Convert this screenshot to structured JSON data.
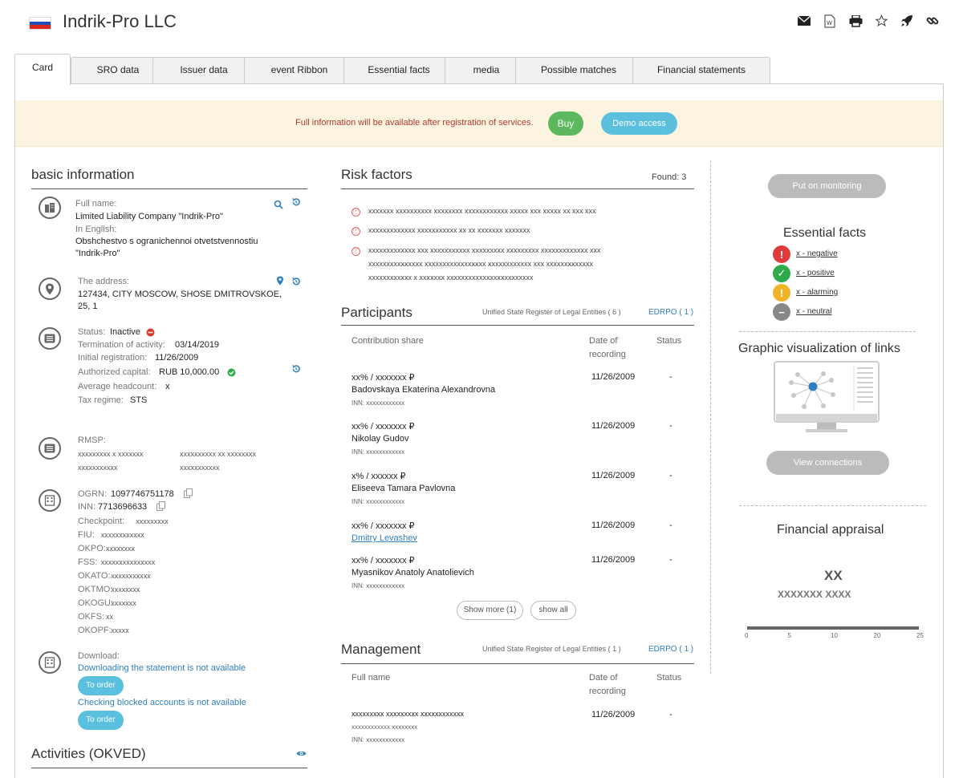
{
  "header": {
    "title": "Indrik-Pro LLC",
    "flag_colors": [
      "#ffffff",
      "#1f4fb5",
      "#d8281e"
    ],
    "toolbar_icons": [
      "mail-icon",
      "word-doc-icon",
      "print-icon",
      "star-icon",
      "rocket-icon",
      "link-icon"
    ]
  },
  "tabs": [
    {
      "label": "Card",
      "active": true
    },
    {
      "label": "SRO data",
      "active": false
    },
    {
      "label": "Issuer data",
      "active": false
    },
    {
      "label": "event Ribbon",
      "active": false
    },
    {
      "label": "Essential facts",
      "active": false
    },
    {
      "label": "media",
      "active": false
    },
    {
      "label": "Possible matches",
      "active": false
    },
    {
      "label": "Financial statements",
      "active": false
    }
  ],
  "banner": {
    "text": "Full information will be available after registration of services.",
    "buy_label": "Buy",
    "demo_label": "Demo access"
  },
  "basic": {
    "heading": "basic information",
    "full_name_label": "Full name:",
    "full_name": "Limited Liability Company \"Indrik-Pro\"",
    "english_label": "In English:",
    "english_1": "Obshchestvo s ogranichennoi otvetstvennostiu",
    "english_2": "\"Indrik-Pro\"",
    "address_label": "The address:",
    "address_1": "127434, CITY MOSCOW, SHOSE DMITROVSKOE,",
    "address_2": "25, 1",
    "status_label": "Status:",
    "status_value": "Inactive",
    "termination_label": "Termination of activity:",
    "termination_value": "03/14/2019",
    "initial_label": "Initial registration:",
    "initial_value": "11/26/2009",
    "capital_label": "Authorized capital:",
    "capital_value": "RUB 10,000.00",
    "headcount_label": "Average headcount:",
    "headcount_value": "x",
    "tax_label": "Tax regime:",
    "tax_value": "STS",
    "rmsp_label": "RMSP:",
    "rmsp_a1": "xxxxxxxxx x xxxxxxx",
    "rmsp_a2": "xxxxxxxxxxx",
    "rmsp_b1": "xxxxxxxxxx xx xxxxxxxx",
    "rmsp_b2": "xxxxxxxxxxx",
    "ogrn_label": "OGRN:",
    "ogrn_value": "1097746751178",
    "inn_label": "INN:",
    "inn_value": "7713696633",
    "codes": [
      {
        "label": "Checkpoint:",
        "value": "xxxxxxxxx"
      },
      {
        "label": "FIU:",
        "value": "xxxxxxxxxxxx"
      },
      {
        "label": "OKPO:",
        "value": "xxxxxxxx"
      },
      {
        "label": "FSS:",
        "value": "xxxxxxxxxxxxxxx"
      },
      {
        "label": "OKATO:",
        "value": "xxxxxxxxxxx"
      },
      {
        "label": "OKTMO:",
        "value": "xxxxxxxx"
      },
      {
        "label": "OKOGU:",
        "value": "xxxxxxx"
      },
      {
        "label": "OKFS:",
        "value": "xx"
      },
      {
        "label": "OKOPF:",
        "value": "xxxxx"
      }
    ],
    "download_label": "Download:",
    "download_statement": "Downloading the statement is not available",
    "order_label": "To order",
    "blocked_accounts": "Checking blocked accounts is not available",
    "activities_heading": "Activities (OKVED)"
  },
  "risk": {
    "heading": "Risk factors",
    "found": "Found: 3",
    "items": [
      [
        "xxxxxxx xxxxxxxxxx xxxxxxxx xxxxxxxxxxxx xxxxx xxx xxxxx xx xxx xxx"
      ],
      [
        "xxxxxxxxxxxxx xxxxxxxxxxx xx xx xxxxxxx xxxxxxx"
      ],
      [
        "xxxxxxxxxxxxx xxx xxxxxxxxxxx xxxxxxxxx xxxxxxxxx xxxxxxxxxxxxx xxx",
        "xxxxxxxxxxxxxxx xxxxxxxxxxxxxxxxx xxxxxxxxxxxx xxx xxxxxxxxxxxxx",
        "xxxxxxxxxxxx x xxxxxxx xxxxxxxxxxxxxxxxxxxxxxxx"
      ]
    ]
  },
  "participants": {
    "heading": "Participants",
    "register_label": "Unified State Register of Legal Entities ( 6 )",
    "edrpo_label": "EDRPO ( 1 )",
    "col_share": "Contribution share",
    "col_date_1": "Date of",
    "col_date_2": "recording",
    "col_status": "Status",
    "rows": [
      {
        "share": "xx% / xxxxxxx ₽",
        "name": "Badovskaya Ekaterina Alexandrovna",
        "inn": "INN: xxxxxxxxxxxx",
        "date": "11/26/2009",
        "status": "-",
        "link": false
      },
      {
        "share": "xx% / xxxxxxx ₽",
        "name": "Nikolay Gudov",
        "inn": "INN: xxxxxxxxxxxx",
        "date": "11/26/2009",
        "status": "-",
        "link": false
      },
      {
        "share": "x% / xxxxxx ₽",
        "name": "Eliseeva Tamara Pavlovna",
        "inn": "INN: xxxxxxxxxxxx",
        "date": "11/26/2009",
        "status": "-",
        "link": false
      },
      {
        "share": "xx% / xxxxxxx ₽",
        "name": "Dmitry Levashev",
        "inn": "",
        "date": "11/26/2009",
        "status": "-",
        "link": true
      },
      {
        "share": "xx% / xxxxxxx ₽",
        "name": "Myasnikov Anatoly Anatolievich",
        "inn": "INN: xxxxxxxxxxxx",
        "date": "11/26/2009",
        "status": "-",
        "link": false
      }
    ],
    "show_more": "Show more (1)",
    "show_all": "show all"
  },
  "management": {
    "heading": "Management",
    "register_label": "Unified State Register of Legal Entities ( 1 )",
    "edrpo_label": "EDRPO ( 1 )",
    "col_name": "Full name",
    "col_date_1": "Date of",
    "col_date_2": "recording",
    "col_status": "Status",
    "row_name_1": "xxxxxxxxx xxxxxxxxx xxxxxxxxxxxx",
    "row_name_2": "xxxxxxxxxxxx xxxxxxxx",
    "row_inn": "INN: xxxxxxxxxxxx",
    "row_date": "11/26/2009",
    "row_status": "-"
  },
  "right": {
    "monitor_label": "Put on monitoring",
    "ef_heading": "Essential facts",
    "ef_items": [
      {
        "text": "x - negative",
        "color": "#e03b3b",
        "glyph": "!"
      },
      {
        "text": "x - positive",
        "color": "#2eaa4a",
        "glyph": "✓"
      },
      {
        "text": "x - alarming",
        "color": "#f0b429",
        "glyph": "!"
      },
      {
        "text": "x - neutral",
        "color": "#888888",
        "glyph": "−"
      }
    ],
    "graph_heading": "Graphic visualization of links",
    "view_label": "View connections",
    "fin_heading": "Financial appraisal",
    "fin_value": "XX",
    "fin_sub": "XXXXXXX XXXX",
    "scale_ticks": [
      "0",
      "5",
      "10",
      "20",
      "25"
    ]
  }
}
